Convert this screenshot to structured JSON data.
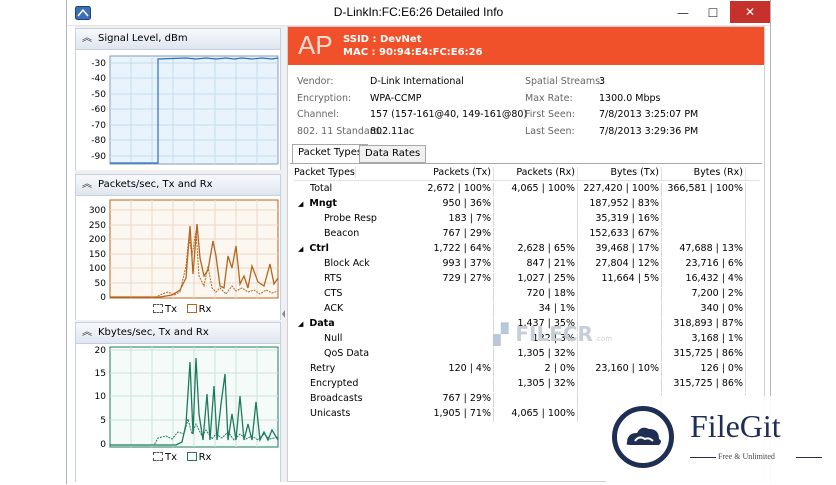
{
  "window": {
    "title": "D-LinkIn:FC:E6:26 Detailed Info",
    "minimize": "—",
    "maximize": "☐",
    "close": "✕"
  },
  "panels": {
    "signal": {
      "title": "Signal Level, dBm",
      "ticks": [
        "-30",
        "-40",
        "-50",
        "-60",
        "-70",
        "-80",
        "-90"
      ]
    },
    "packets": {
      "title": "Packets/sec, Tx and Rx",
      "ticks": [
        "300",
        "250",
        "200",
        "150",
        "100",
        "50",
        "0"
      ],
      "legend_tx": "Tx",
      "legend_rx": "Rx"
    },
    "kbytes": {
      "title": "Kbytes/sec, Tx and Rx",
      "ticks": [
        "20",
        "15",
        "10",
        "5",
        "0"
      ],
      "legend_tx": "Tx",
      "legend_rx": "Rx"
    }
  },
  "ap": {
    "badge": "AP",
    "ssid": "SSID : DevNet",
    "mac": "MAC : 90:94:E4:FC:E6:26"
  },
  "info": {
    "vendor_label": "Vendor:",
    "vendor": "D-Link International",
    "encryption_label": "Encryption:",
    "encryption": "WPA-CCMP",
    "channel_label": "Channel:",
    "channel": "157 (157-161@40, 149-161@80)",
    "standard_label": "802. 11 Standard:",
    "standard": "802.11ac",
    "streams_label": "Spatial Streams:",
    "streams": "3",
    "maxrate_label": "Max Rate:",
    "maxrate": "1300.0 Mbps",
    "firstseen_label": "First Seen:",
    "firstseen": "7/8/2013 3:25:07 PM",
    "lastseen_label": "Last Seen:",
    "lastseen": "7/8/2013 3:29:36 PM"
  },
  "tabs": [
    "Packet Types",
    "Data Rates"
  ],
  "table": {
    "headers": [
      "Packet Types",
      "Packets (Tx)",
      "Packets (Rx)",
      "Bytes (Tx)",
      "Bytes (Rx)"
    ],
    "rows": [
      {
        "name": "Total",
        "level": 1,
        "ptx": "2,672 | 100%",
        "prx": "4,065 | 100%",
        "btx": "227,420 | 100%",
        "brx": "366,581 | 100%"
      },
      {
        "name": "Mngt",
        "level": 0,
        "ptx": "950 | 36%",
        "prx": "",
        "btx": "187,952 | 83%",
        "brx": ""
      },
      {
        "name": "Probe Resp",
        "level": 2,
        "ptx": "183 | 7%",
        "prx": "",
        "btx": "35,319 | 16%",
        "brx": ""
      },
      {
        "name": "Beacon",
        "level": 2,
        "ptx": "767 | 29%",
        "prx": "",
        "btx": "152,633 | 67%",
        "brx": ""
      },
      {
        "name": "Ctrl",
        "level": 0,
        "ptx": "1,722 | 64%",
        "prx": "2,628 | 65%",
        "btx": "39,468 | 17%",
        "brx": "47,688 | 13%"
      },
      {
        "name": "Block Ack",
        "level": 2,
        "ptx": "993 | 37%",
        "prx": "847 | 21%",
        "btx": "27,804 | 12%",
        "brx": "23,716 | 6%"
      },
      {
        "name": "RTS",
        "level": 2,
        "ptx": "729 | 27%",
        "prx": "1,027 | 25%",
        "btx": "11,664 | 5%",
        "brx": "16,432 | 4%"
      },
      {
        "name": "CTS",
        "level": 2,
        "ptx": "",
        "prx": "720 | 18%",
        "btx": "",
        "brx": "7,200 | 2%"
      },
      {
        "name": "ACK",
        "level": 2,
        "ptx": "",
        "prx": "34 | 1%",
        "btx": "",
        "brx": "340 | 0%"
      },
      {
        "name": "Data",
        "level": 0,
        "ptx": "",
        "prx": "1,437 | 35%",
        "btx": "",
        "brx": "318,893 | 87%"
      },
      {
        "name": "Null",
        "level": 2,
        "ptx": "",
        "prx": "132 | 3%",
        "btx": "",
        "brx": "3,168 | 1%"
      },
      {
        "name": "QoS Data",
        "level": 2,
        "ptx": "",
        "prx": "1,305 | 32%",
        "btx": "",
        "brx": "315,725 | 86%"
      },
      {
        "name": "Retry",
        "level": 1,
        "ptx": "120 | 4%",
        "prx": "2 | 0%",
        "btx": "23,160 | 10%",
        "brx": "126 | 0%"
      },
      {
        "name": "Encrypted",
        "level": 1,
        "ptx": "",
        "prx": "1,305 | 32%",
        "btx": "",
        "brx": "315,725 | 86%"
      },
      {
        "name": "Broadcasts",
        "level": 1,
        "ptx": "767 | 29%",
        "prx": "",
        "btx": "",
        "brx": ""
      },
      {
        "name": "Unicasts",
        "level": 1,
        "ptx": "1,905 | 71%",
        "prx": "4,065 | 100%",
        "btx": "",
        "brx": ""
      }
    ]
  },
  "watermarks": {
    "filecr": "FILECR",
    "filecr_suffix": ".com",
    "filegit": "FileGit",
    "filegit_sub": "Free & Unlimited"
  },
  "colors": {
    "ap_banner": "#f0502a",
    "signal_line": "#2f6fbf",
    "packets_line": "#b5651d",
    "kbytes_line": "#1e7a5a",
    "filegit": "#1f2e55"
  }
}
